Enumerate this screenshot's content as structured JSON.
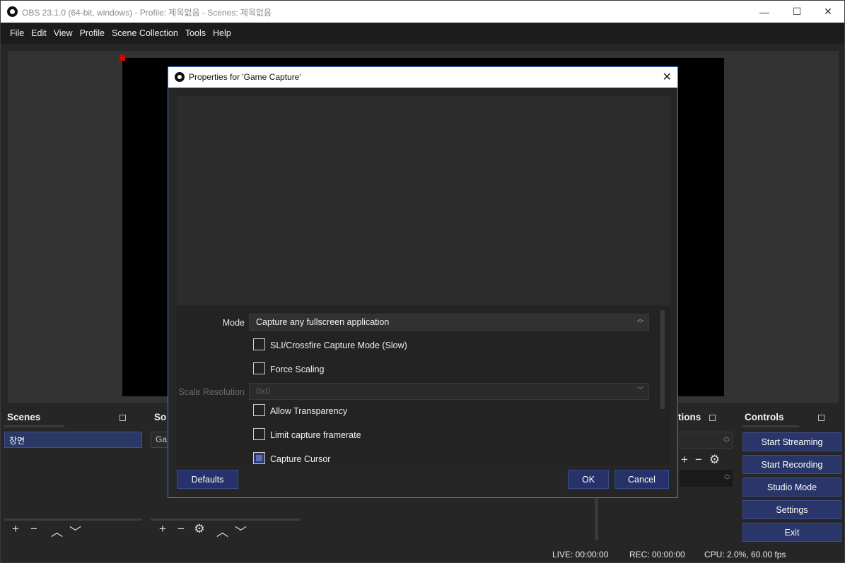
{
  "window": {
    "title": "OBS 23.1.0 (64-bit, windows) - Profile: 제목없음 - Scenes: 제목없음",
    "minimize": "—",
    "maximize": "☐",
    "close": "✕"
  },
  "menu": [
    "File",
    "Edit",
    "View",
    "Profile",
    "Scene Collection",
    "Tools",
    "Help"
  ],
  "docks": {
    "scenes_title": "Scenes",
    "scene_items": [
      "장면"
    ],
    "sources_title_partial": "So",
    "source_items_partial": [
      "Ga"
    ],
    "transitions_title_partial": "tions",
    "controls_title": "Controls"
  },
  "controls": {
    "start_streaming": "Start Streaming",
    "start_recording": "Start Recording",
    "studio_mode": "Studio Mode",
    "settings": "Settings",
    "exit": "Exit"
  },
  "toolbar_icons": {
    "add": "+",
    "remove": "−",
    "up": "︿",
    "down": "﹀",
    "gear": "⚙"
  },
  "status": {
    "live": "LIVE: 00:00:00",
    "rec": "REC: 00:00:00",
    "cpu": "CPU: 2.0%, 60.00 fps"
  },
  "dialog": {
    "title": "Properties for 'Game Capture'",
    "close": "✕",
    "mode_label": "Mode",
    "mode_value": "Capture any fullscreen application",
    "sli_label": "SLI/Crossfire Capture Mode (Slow)",
    "sli_checked": false,
    "force_scaling_label": "Force Scaling",
    "force_scaling_checked": false,
    "scale_res_label": "Scale Resolution",
    "scale_res_value": "0x0",
    "allow_transparency_label": "Allow Transparency",
    "allow_transparency_checked": false,
    "limit_framerate_label": "Limit capture framerate",
    "limit_framerate_checked": false,
    "capture_cursor_label": "Capture Cursor",
    "capture_cursor_checked": true,
    "defaults_button": "Defaults",
    "ok_button": "OK",
    "cancel_button": "Cancel"
  }
}
